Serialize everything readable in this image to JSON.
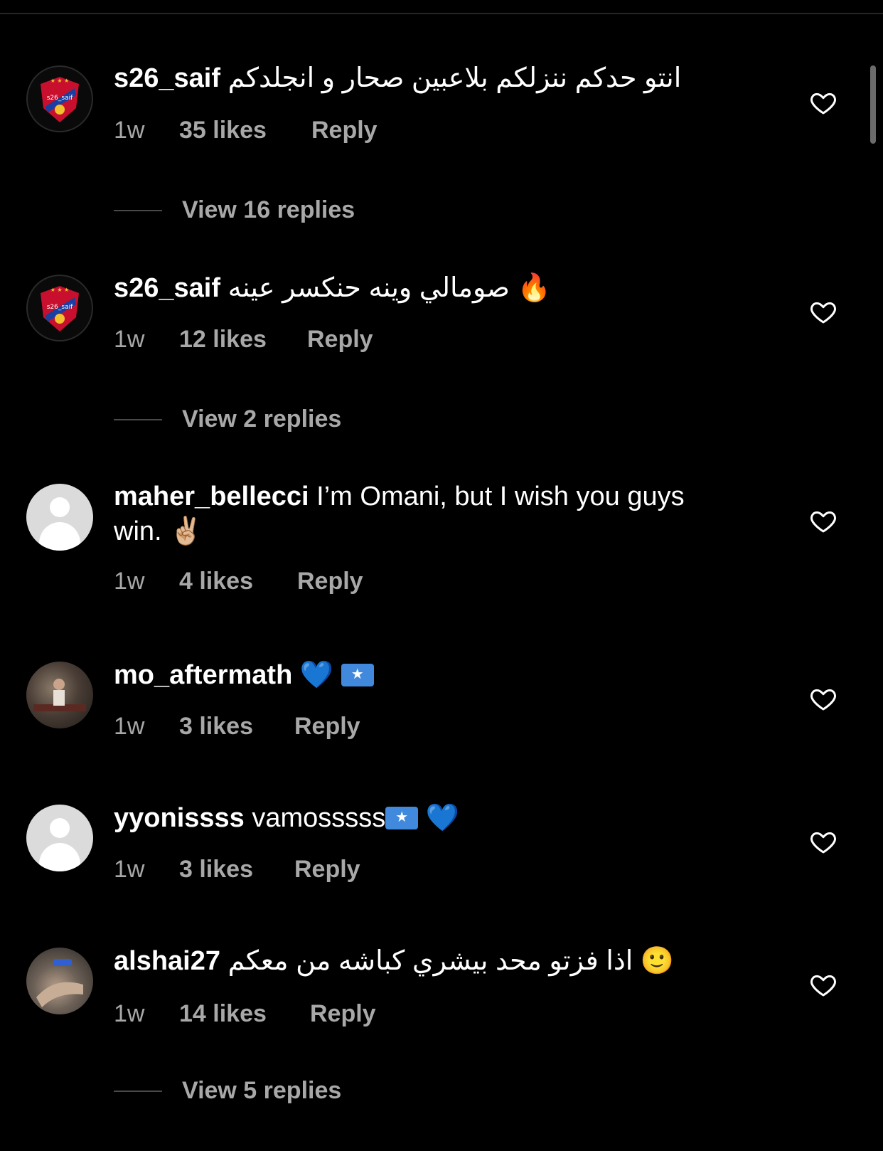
{
  "comments": [
    {
      "username": "s26_saif",
      "text": "انتو حدكم ننزلكم بلاعبين صحار و انجلدكم",
      "time": "1w",
      "likes": "35 likes",
      "reply": "Reply",
      "view_replies": "View 16 replies",
      "avatar_label": "s26_saif"
    },
    {
      "username": "s26_saif",
      "text": "صومالي وينه حنكسر عينه",
      "emoji": "🔥",
      "time": "1w",
      "likes": "12 likes",
      "reply": "Reply",
      "view_replies": "View 2 replies",
      "avatar_label": "s26_saif"
    },
    {
      "username": "maher_bellecci",
      "text": "I’m Omani, but I wish you guys",
      "text_line2": "win.",
      "emoji": "✌🏼",
      "time": "1w",
      "likes": "4 likes",
      "reply": "Reply"
    },
    {
      "username": "mo_aftermath",
      "emoji": "💙",
      "time": "1w",
      "likes": "3 likes",
      "reply": "Reply"
    },
    {
      "username": "yyonissss",
      "text": "vamosssss",
      "emoji": "💙",
      "time": "1w",
      "likes": "3 likes",
      "reply": "Reply"
    },
    {
      "username": "alshai27",
      "text": "اذا فزتو محد بيشري كباشه من معكم",
      "emoji": "🙂",
      "time": "1w",
      "likes": "14 likes",
      "reply": "Reply",
      "view_replies": "View 5 replies"
    }
  ],
  "icons": {
    "like": "heart-outline-icon",
    "flag": "somalia-flag-icon"
  },
  "colors": {
    "background": "#000000",
    "meta_text": "#a8a8a8",
    "primary_text": "#ffffff"
  }
}
